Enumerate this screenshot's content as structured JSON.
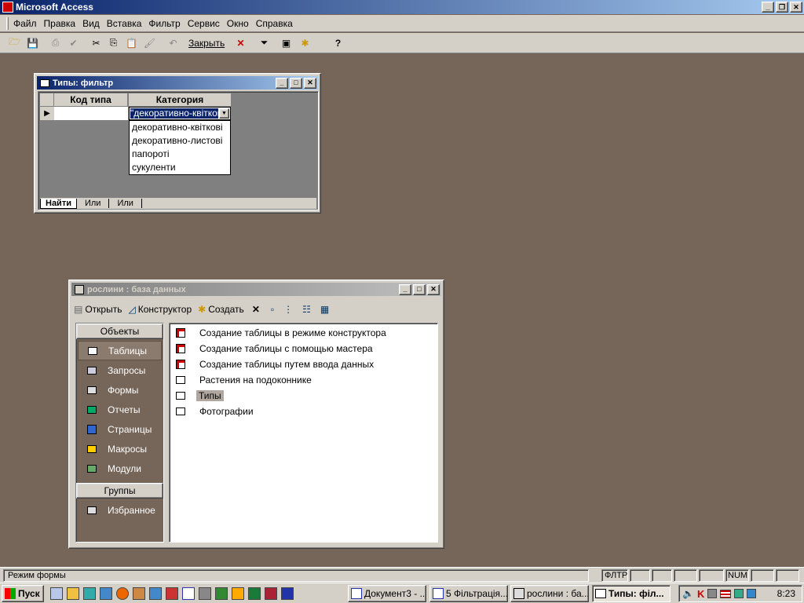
{
  "app": {
    "title": "Microsoft Access",
    "menu": [
      "Файл",
      "Правка",
      "Вид",
      "Вставка",
      "Фильтр",
      "Сервис",
      "Окно",
      "Справка"
    ],
    "toolbar_close_label": "Закрыть"
  },
  "filter_window": {
    "title": "Типы: фильтр",
    "col_code": "Код типа",
    "col_category": "Категория",
    "category_value": "\"декоративно-квіткові\"",
    "dropdown_options": [
      "декоративно-квіткові",
      "декоративно-листові",
      "папороті",
      "сукуленти"
    ],
    "tabs": [
      "Найти",
      "Или",
      "Или"
    ]
  },
  "db_window": {
    "title": "рослини : база данных",
    "toolbar": {
      "open": "Открыть",
      "design": "Конструктор",
      "create": "Создать"
    },
    "objects_header": "Объекты",
    "objects": [
      {
        "label": "Таблицы",
        "icon": "table-icon"
      },
      {
        "label": "Запросы",
        "icon": "query-icon"
      },
      {
        "label": "Формы",
        "icon": "form-icon"
      },
      {
        "label": "Отчеты",
        "icon": "report-icon"
      },
      {
        "label": "Страницы",
        "icon": "page-icon"
      },
      {
        "label": "Макросы",
        "icon": "macro-icon"
      },
      {
        "label": "Модули",
        "icon": "module-icon"
      }
    ],
    "groups_header": "Группы",
    "groups": [
      {
        "label": "Избранное",
        "icon": "favorites-icon"
      }
    ],
    "items": [
      {
        "label": "Создание таблицы в режиме конструктора",
        "icon": "shortcut-icon"
      },
      {
        "label": "Создание таблицы с помощью мастера",
        "icon": "shortcut-icon"
      },
      {
        "label": "Создание таблицы путем ввода данных",
        "icon": "shortcut-icon"
      },
      {
        "label": "Растения на подоконнике",
        "icon": "table-icon"
      },
      {
        "label": "Типы",
        "icon": "table-icon"
      },
      {
        "label": "Фотографии",
        "icon": "table-icon"
      }
    ]
  },
  "status": {
    "text": "Режим формы",
    "filter": "ФЛТР",
    "num": "NUM"
  },
  "taskbar": {
    "start": "Пуск",
    "tasks": [
      "Документ3 - ...",
      "5 Фільтрація...",
      "рослини : ба...",
      "Типы: філ..."
    ],
    "clock": "8:23"
  },
  "colors": {
    "desktop": "#756659",
    "active_title": "#0a246a",
    "inactive_title": "#808080",
    "face": "#d4d0c8"
  }
}
